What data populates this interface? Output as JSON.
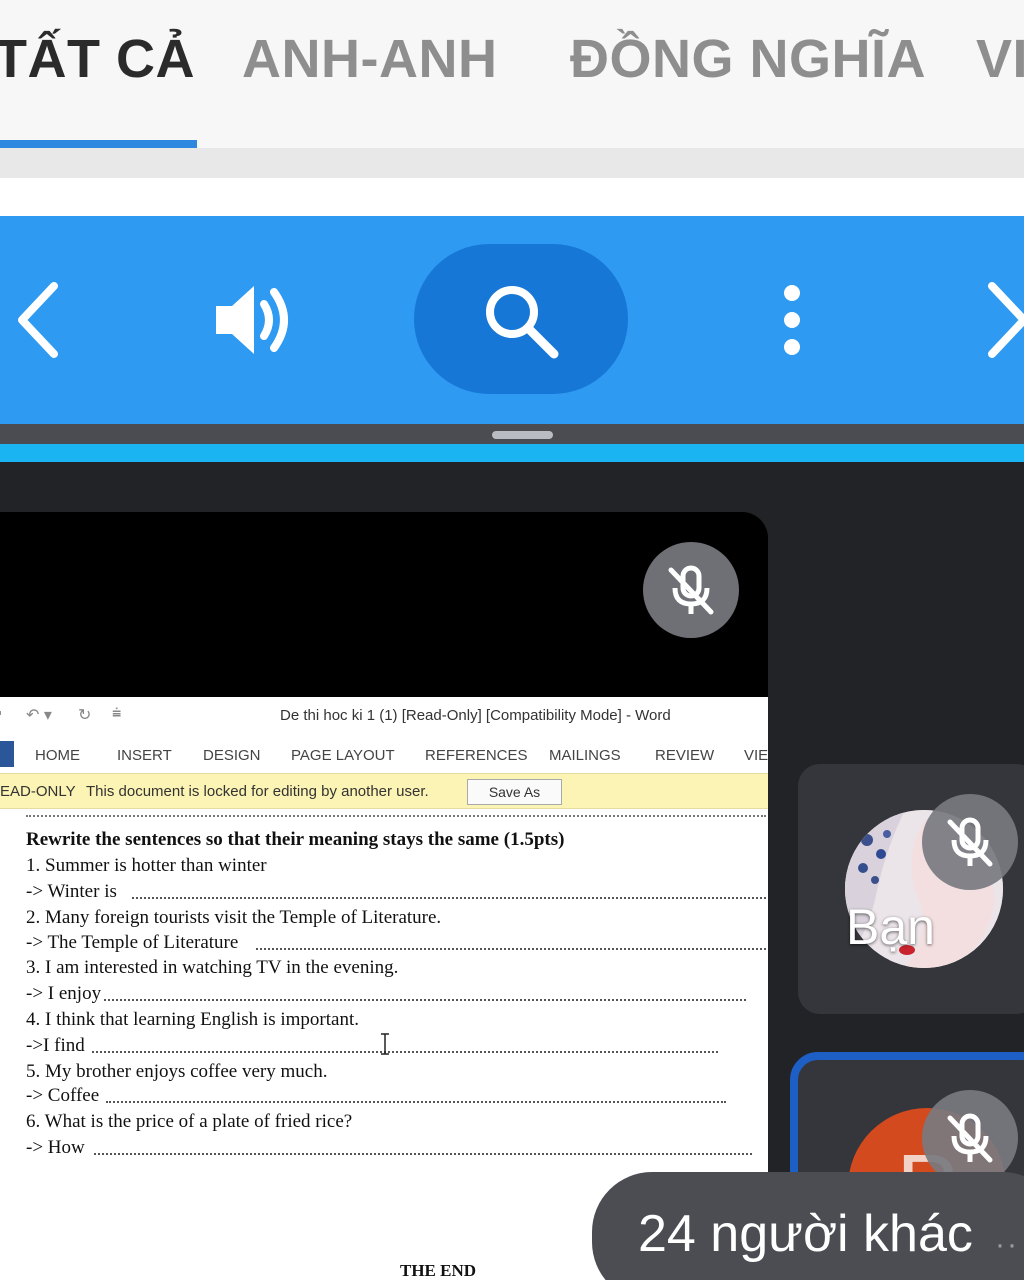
{
  "tabs": [
    {
      "label": "TẤT CẢ",
      "active": true
    },
    {
      "label": "ANH-ANH",
      "active": false
    },
    {
      "label": "ĐỒNG NGHĨA",
      "active": false
    },
    {
      "label": "VI",
      "active": false
    }
  ],
  "toolbar": {
    "icons": [
      "back-chevron-icon",
      "speaker-icon",
      "search-icon",
      "more-vertical-icon",
      "forward-chevron-icon"
    ],
    "accent": "#2e9af2",
    "active_pill": "#1677d6"
  },
  "word": {
    "window_title": "De thi hoc ki 1 (1) [Read-Only] [Compatibility Mode] - Word",
    "ribbon_tabs": [
      "HOME",
      "INSERT",
      "DESIGN",
      "PAGE LAYOUT",
      "REFERENCES",
      "MAILINGS",
      "REVIEW",
      "VIE"
    ],
    "readonly_label": "EAD-ONLY",
    "readonly_message": "This document is locked for editing by another user.",
    "save_as": "Save As",
    "heading": "Rewrite the sentences so that their meaning stays the same (1.5pts)",
    "lines": [
      "1. Summer is hotter than winter",
      "-> Winter is",
      "2. Many foreign tourists visit the Temple of Literature.",
      "-> The Temple of Literature",
      "3. I am interested in watching TV in the evening.",
      "-> I enjoy",
      "4. I think that learning English is important.",
      "->I find",
      "5. My brother enjoys coffee very much.",
      "-> Coffee",
      "6. What is the price of a plate of fried rice?",
      "-> How"
    ],
    "end_text": "THE END"
  },
  "participants": {
    "self_label": "Bạn",
    "other_initial": "P",
    "others_count_text": "24 người khác",
    "others_more": "··"
  }
}
